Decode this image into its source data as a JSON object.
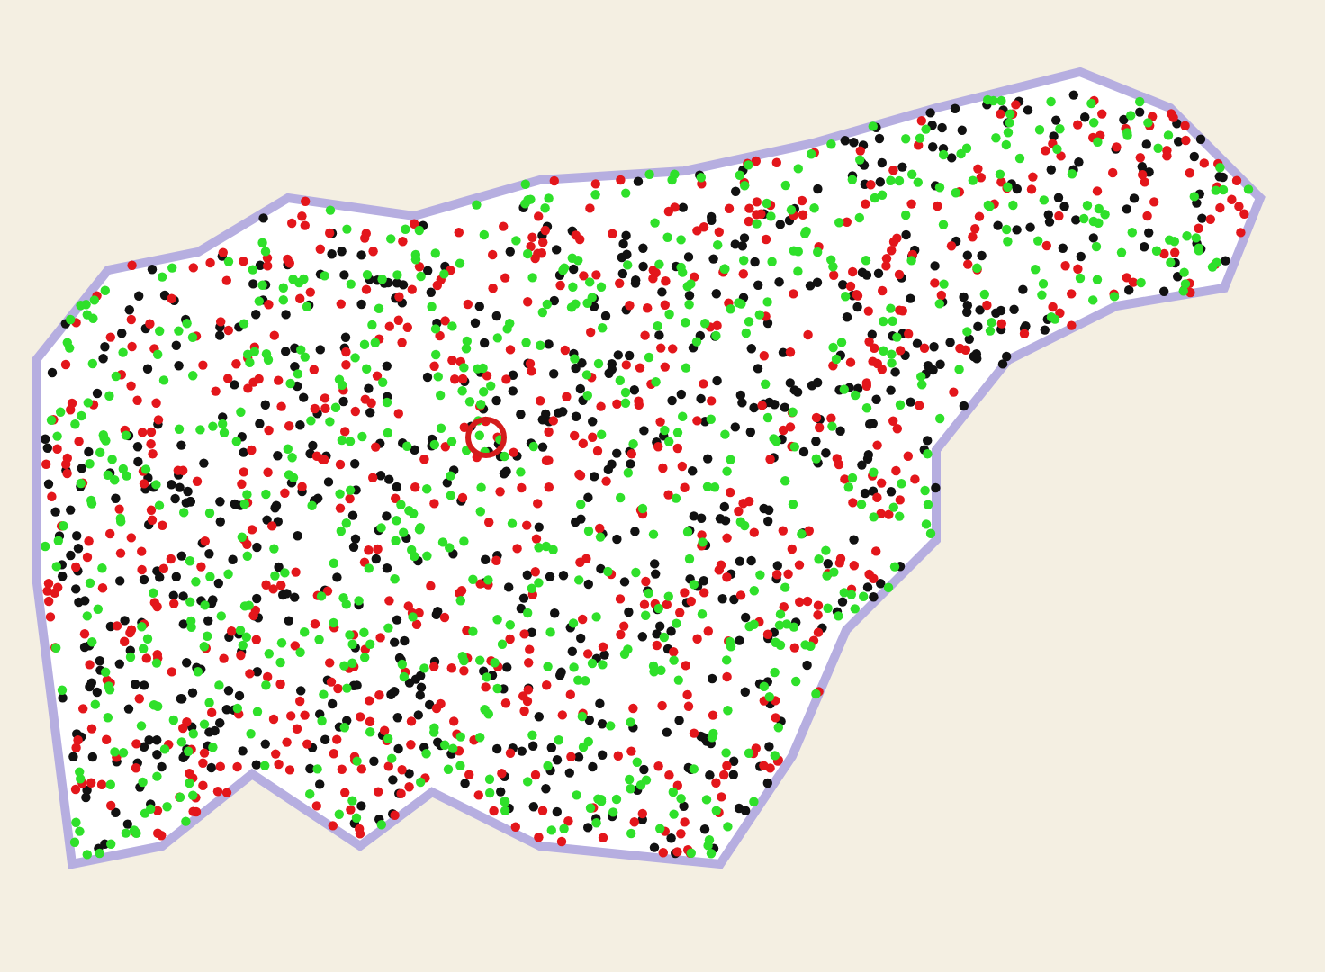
{
  "map": {
    "point_groups": [
      {
        "color": "#111111"
      },
      {
        "color": "#e3161b"
      },
      {
        "color": "#2fe02a"
      }
    ],
    "marker": {
      "shown": true
    }
  }
}
